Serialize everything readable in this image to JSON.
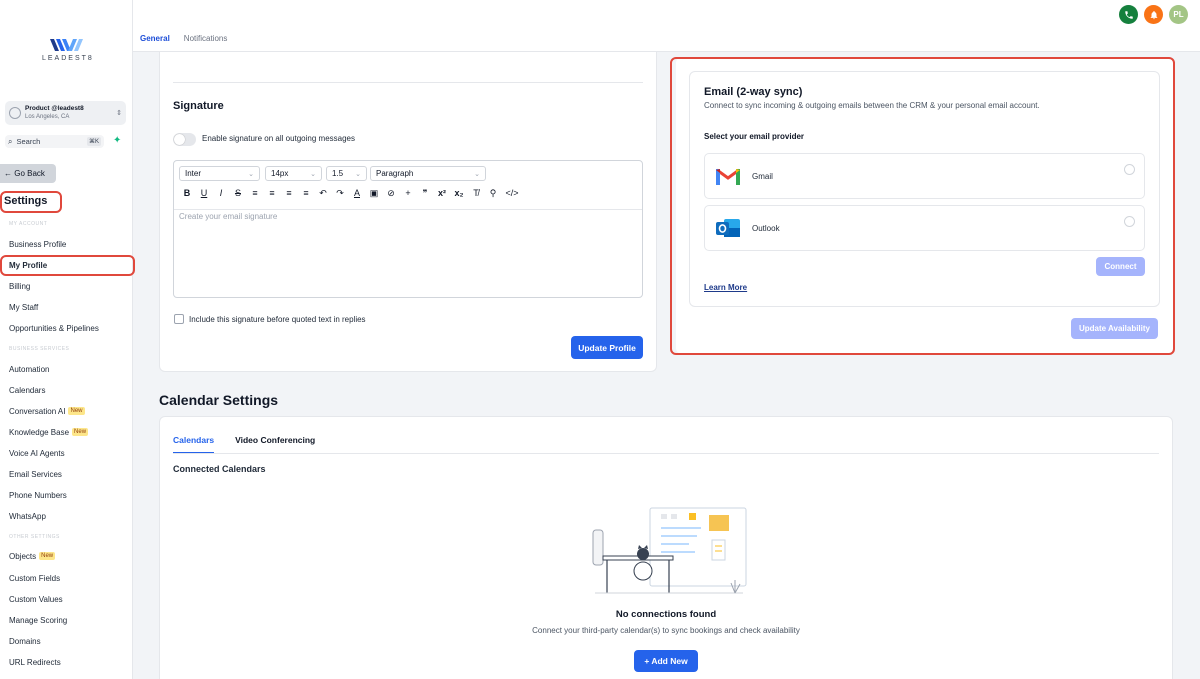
{
  "header": {
    "tabs": [
      {
        "label": "General",
        "active": true
      },
      {
        "label": "Notifications",
        "active": false
      }
    ],
    "avatar_initials": "PL"
  },
  "sidebar": {
    "logo_text": "LEADEST8",
    "account": {
      "name": "Product @leadest8",
      "location": "Los Angeles, CA"
    },
    "search": {
      "label": "Search",
      "shortcut": "⌘K"
    },
    "go_back": "Go Back",
    "title": "Settings",
    "sections": {
      "my_account": "MY ACCOUNT",
      "business_services": "BUSINESS SERVICES",
      "other_settings": "OTHER SETTINGS"
    },
    "items": {
      "business_profile": "Business Profile",
      "my_profile": "My Profile",
      "billing": "Billing",
      "my_staff": "My Staff",
      "opportunities": "Opportunities & Pipelines",
      "automation": "Automation",
      "calendars": "Calendars",
      "conversation_ai": "Conversation AI",
      "knowledge_base": "Knowledge Base",
      "voice_ai": "Voice AI Agents",
      "email_services": "Email Services",
      "phone_numbers": "Phone Numbers",
      "whatsapp": "WhatsApp",
      "objects": "Objects",
      "custom_fields": "Custom Fields",
      "custom_values": "Custom Values",
      "manage_scoring": "Manage Scoring",
      "domains": "Domains",
      "url_redirects": "URL Redirects"
    },
    "new_badge": "New"
  },
  "signature": {
    "title": "Signature",
    "toggle_label": "Enable signature on all outgoing messages",
    "font": "Inter",
    "size": "14px",
    "line_height": "1.5",
    "block": "Paragraph",
    "toolbar": [
      "B",
      "U",
      "I",
      "S",
      "≡",
      "≡",
      "≡",
      "≡",
      "↶",
      "↷",
      "A",
      "▣",
      "⊘",
      "+",
      "❞",
      "x²",
      "x₂",
      "T̸",
      "⚲",
      "</>"
    ],
    "placeholder": "Create your email signature",
    "include_label": "Include this signature before quoted text in replies",
    "update_button": "Update Profile"
  },
  "email_sync": {
    "title": "Email (2-way sync)",
    "subtitle": "Connect to sync incoming & outgoing emails between the CRM & your personal email account.",
    "provider_label": "Select your email provider",
    "providers": [
      {
        "name": "Gmail"
      },
      {
        "name": "Outlook"
      }
    ],
    "connect_button": "Connect",
    "learn_more": "Learn More",
    "update_button": "Update Availability"
  },
  "calendar_settings": {
    "title": "Calendar Settings",
    "tabs": [
      {
        "label": "Calendars",
        "active": true
      },
      {
        "label": "Video Conferencing",
        "active": false
      }
    ],
    "connected_title": "Connected Calendars",
    "empty_title": "No connections found",
    "empty_subtitle": "Connect your third-party calendar(s) to sync bookings and check availability",
    "add_button": "+ Add New"
  },
  "colors": {
    "primary": "#2563eb",
    "highlight": "#e0483c",
    "disabled": "#a5b4fc"
  }
}
